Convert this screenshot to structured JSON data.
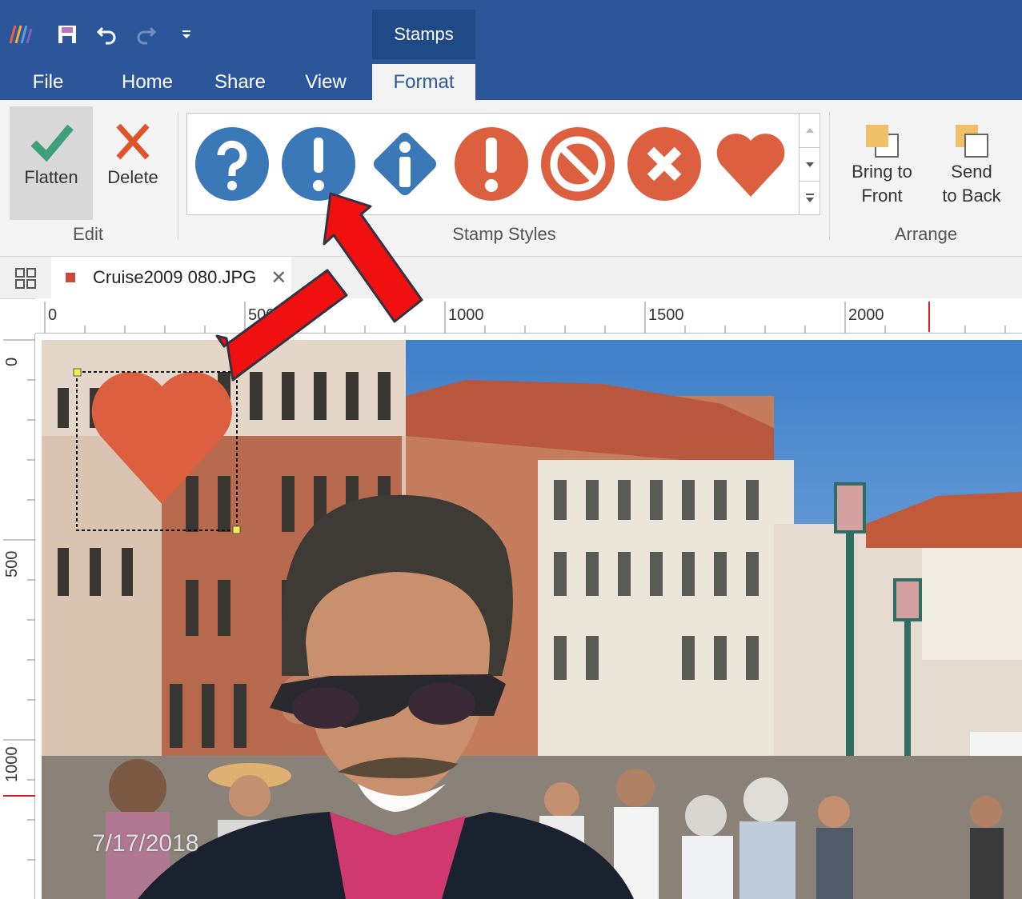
{
  "title_bar": {
    "context_tab": "Stamps",
    "icons": [
      "app-logo-icon",
      "save-icon",
      "undo-icon",
      "redo-icon",
      "customize-qat-icon"
    ],
    "accent": "#2b579a"
  },
  "tabs": [
    {
      "label": "File"
    },
    {
      "label": "Home"
    },
    {
      "label": "Share"
    },
    {
      "label": "View"
    },
    {
      "label": "Format",
      "active": true
    }
  ],
  "ribbon": {
    "edit": {
      "flatten": "Flatten",
      "delete": "Delete",
      "group_label": "Edit"
    },
    "stamp_styles": {
      "group_label": "Stamp Styles",
      "stamps": [
        "question-stamp-icon",
        "exclamation-stamp-icon",
        "info-stamp-icon",
        "warning-stamp-icon",
        "prohibited-stamp-icon",
        "cancel-stamp-icon",
        "heart-stamp-icon"
      ],
      "blue": "#3b78b8",
      "red": "#dc6040"
    },
    "arrange": {
      "bring_front_l1": "Bring to",
      "bring_front_l2": "Front",
      "send_back_l1": "Send",
      "send_back_l2": "to Back",
      "group_label": "Arrange"
    }
  },
  "document": {
    "tab_name": "Cruise2009 080.JPG"
  },
  "ruler": {
    "horizontal": [
      "0",
      "500",
      "1000",
      "1500",
      "2000"
    ],
    "vertical": [
      "0",
      "500",
      "1000"
    ]
  },
  "photo": {
    "date_stamp": "7/17/2018"
  }
}
